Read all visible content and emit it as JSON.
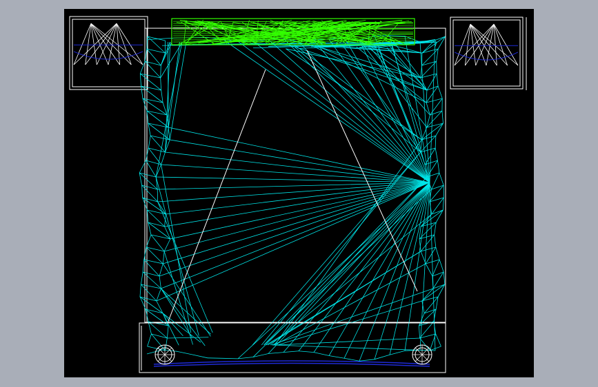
{
  "app": {
    "background_color": "#a9aeb8",
    "viewport_color": "#000000"
  },
  "drawing": {
    "subject": "bed-plan-wireframe",
    "colors": {
      "outline": "#ffffff",
      "mesh": "#00e5e8",
      "pillow": "#33ff00",
      "accent": "#1e2ad6"
    },
    "components": [
      {
        "name": "left-nightstand",
        "icon": "fan-hatch-icon"
      },
      {
        "name": "right-nightstand",
        "icon": "fan-hatch-icon"
      },
      {
        "name": "bed-frame",
        "icon": "rectangle-outline-icon"
      },
      {
        "name": "pillow",
        "icon": "green-mesh-icon"
      },
      {
        "name": "mattress-mesh",
        "icon": "triangulated-mesh-icon"
      },
      {
        "name": "footboard",
        "icon": "rectangle-outline-icon"
      },
      {
        "name": "left-caster",
        "icon": "wheel-icon"
      },
      {
        "name": "right-caster",
        "icon": "wheel-icon"
      }
    ],
    "caption": ""
  }
}
